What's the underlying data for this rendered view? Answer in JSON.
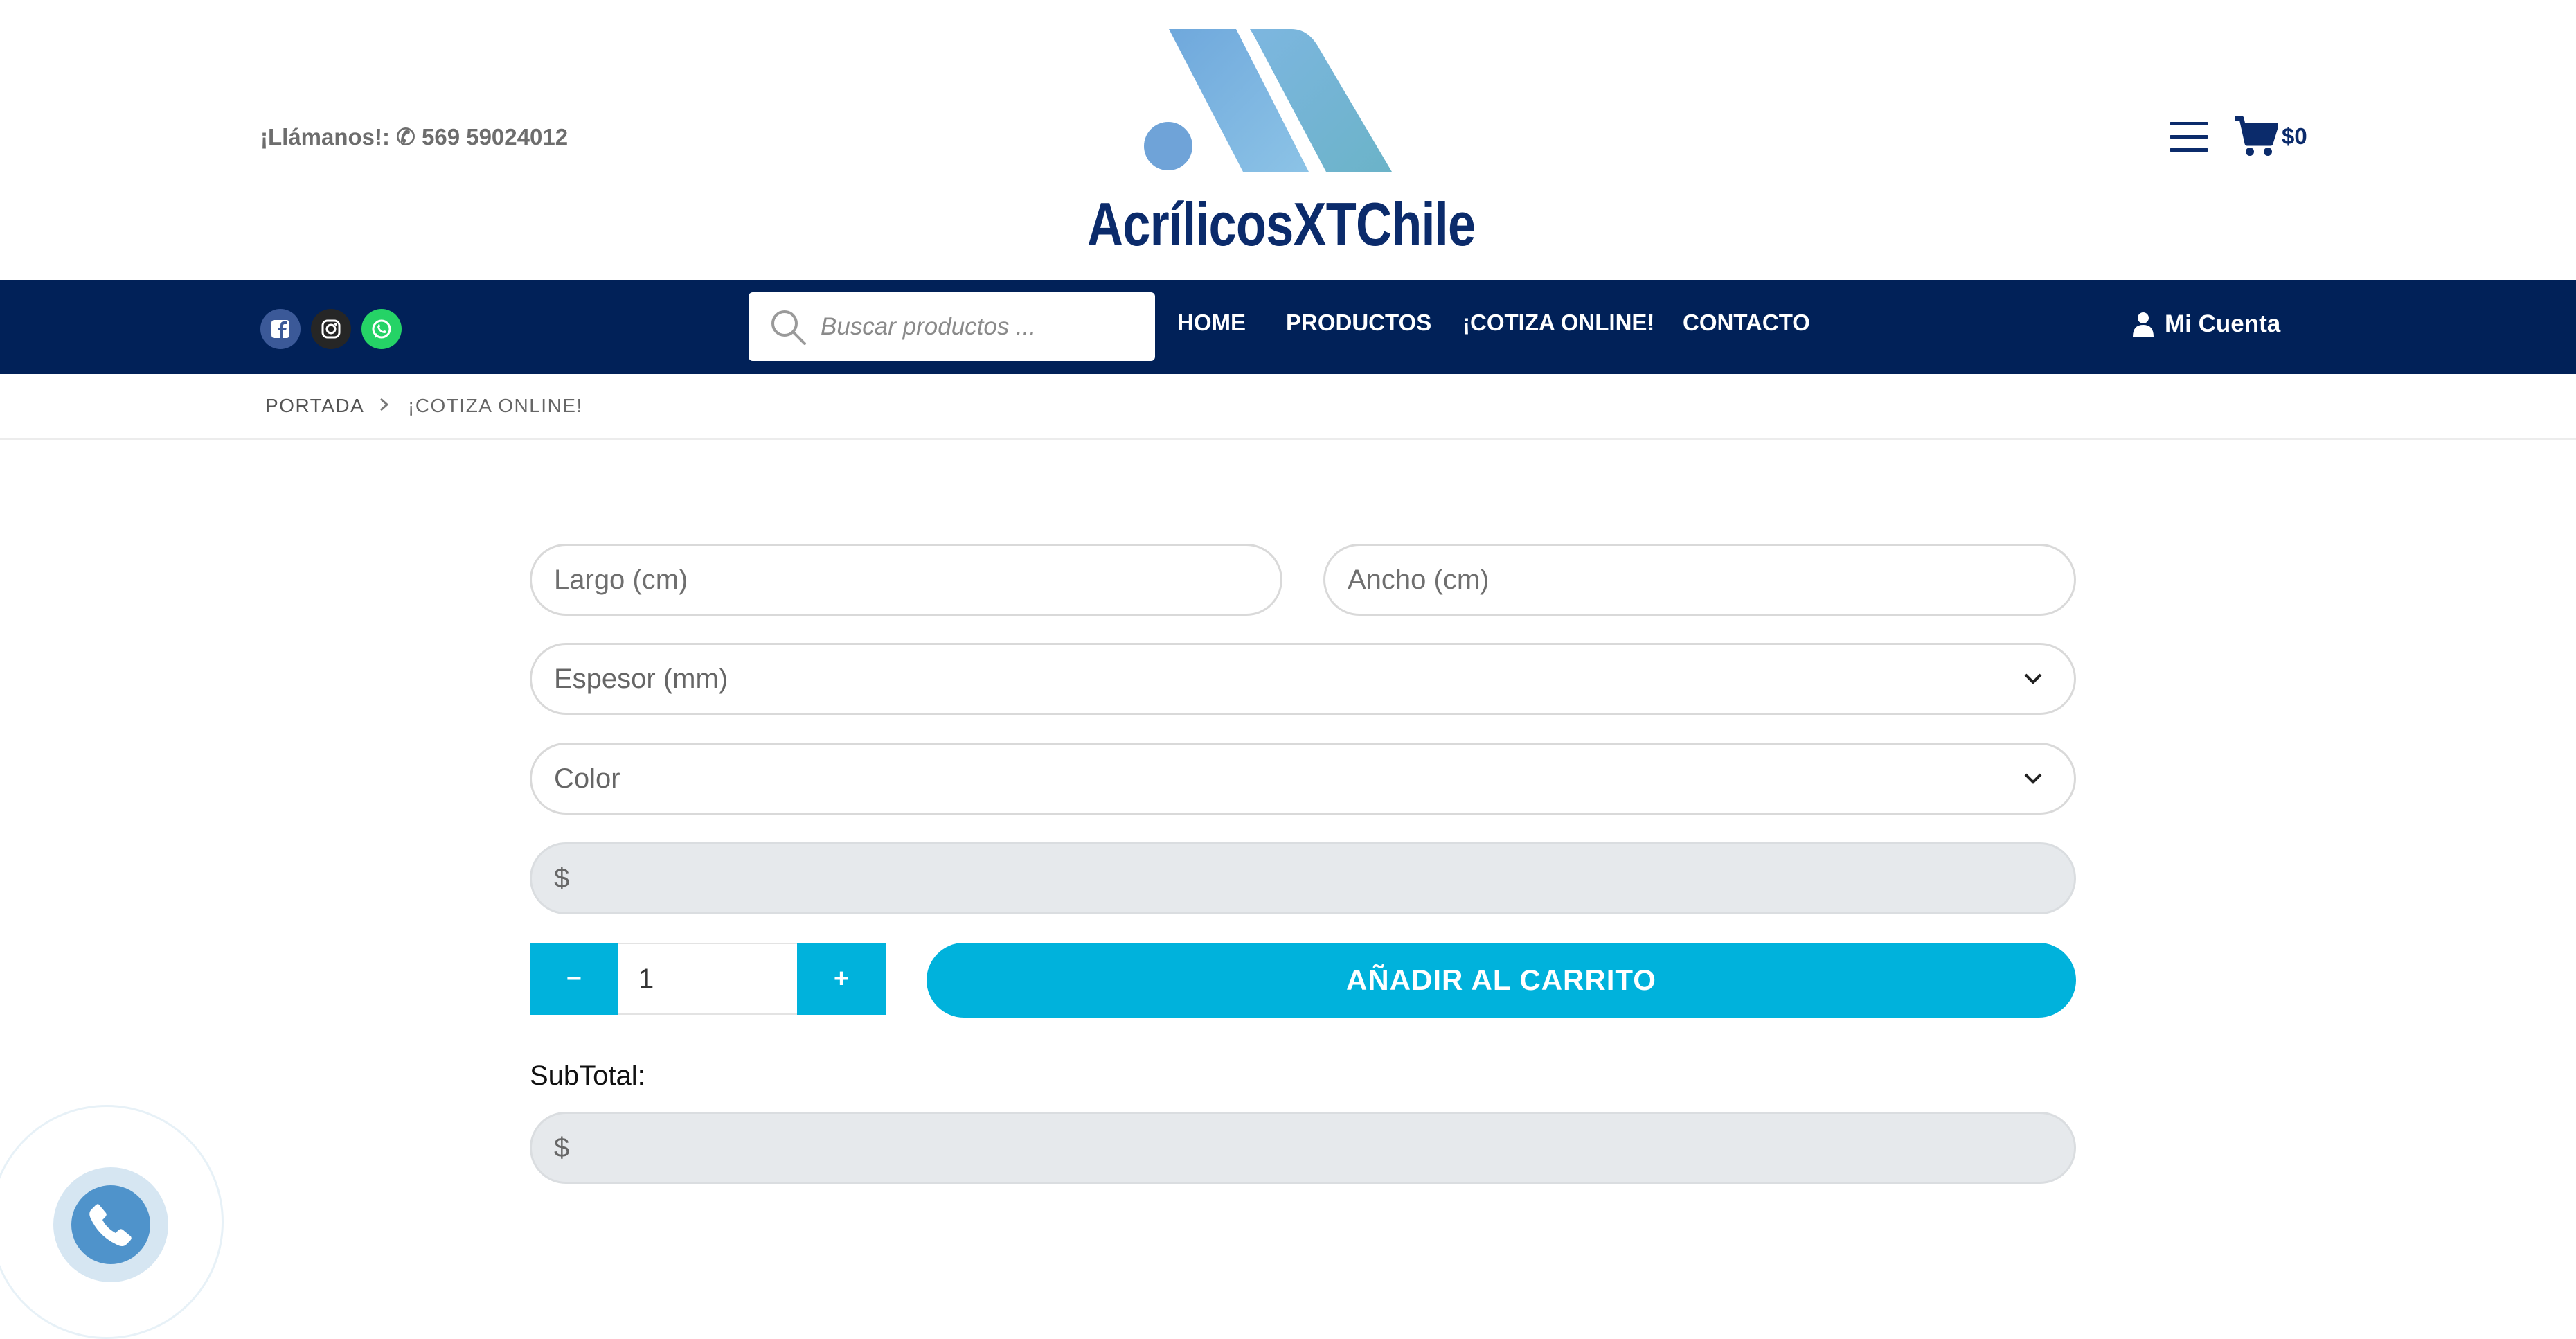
{
  "header": {
    "phone_text": "¡Llámanos!: ✆ 569 59024012",
    "logo_text": "AcrílicosXTChile",
    "cart_total": "$0",
    "menu_icon": "hamburger-menu-icon",
    "cart_icon": "shopping-cart-icon"
  },
  "navbar": {
    "social": [
      {
        "name": "facebook",
        "icon": "facebook-icon",
        "color": "#3b5998"
      },
      {
        "name": "instagram",
        "icon": "instagram-icon",
        "color": "#262626"
      },
      {
        "name": "whatsapp",
        "icon": "whatsapp-icon",
        "color": "#25d366"
      }
    ],
    "search_placeholder": "Buscar productos ...",
    "links": [
      "HOME",
      "PRODUCTOS",
      "¡COTIZA ONLINE!",
      "CONTACTO"
    ],
    "account_label": "Mi Cuenta",
    "background": "#012158"
  },
  "breadcrumb": {
    "home": "PORTADA",
    "current": "¡COTIZA ONLINE!"
  },
  "form": {
    "largo_placeholder": "Largo (cm)",
    "ancho_placeholder": "Ancho (cm)",
    "espesor_value": "Espesor (mm)",
    "color_value": "Color",
    "price_value": "$",
    "quantity": "1",
    "minus_label": "−",
    "plus_label": "+",
    "add_to_cart_label": "AÑADIR AL CARRITO",
    "subtotal_label": "SubTotal:",
    "subtotal_value": "$",
    "accent_color": "#00b2dc"
  },
  "floating": {
    "call_icon": "phone-icon"
  }
}
